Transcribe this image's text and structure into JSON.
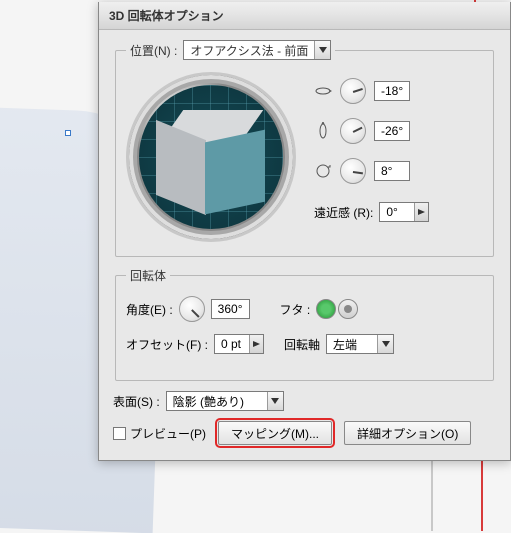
{
  "dialog": {
    "title": "3D 回転体オプション",
    "position_group": {
      "legend": "位置(N) :",
      "select": "オフアクシス法 - 前面",
      "rot_x": "-18°",
      "rot_y": "-26°",
      "rot_z": "8°",
      "perspective_label": "遠近感 (R):",
      "perspective_value": "0°"
    },
    "revolve_group": {
      "legend": "回転体",
      "angle_label": "角度(E) :",
      "angle_value": "360°",
      "cap_label": "フタ :",
      "offset_label": "オフセット(F) :",
      "offset_value": "0 pt",
      "axis_label": "回転軸",
      "axis_value": "左端"
    },
    "surface": {
      "label": "表面(S) :",
      "value": "陰影 (艶あり)"
    },
    "footer": {
      "preview_label": "プレビュー(P)",
      "mapping_btn": "マッピング(M)...",
      "more_btn": "詳細オプション(O)"
    }
  }
}
